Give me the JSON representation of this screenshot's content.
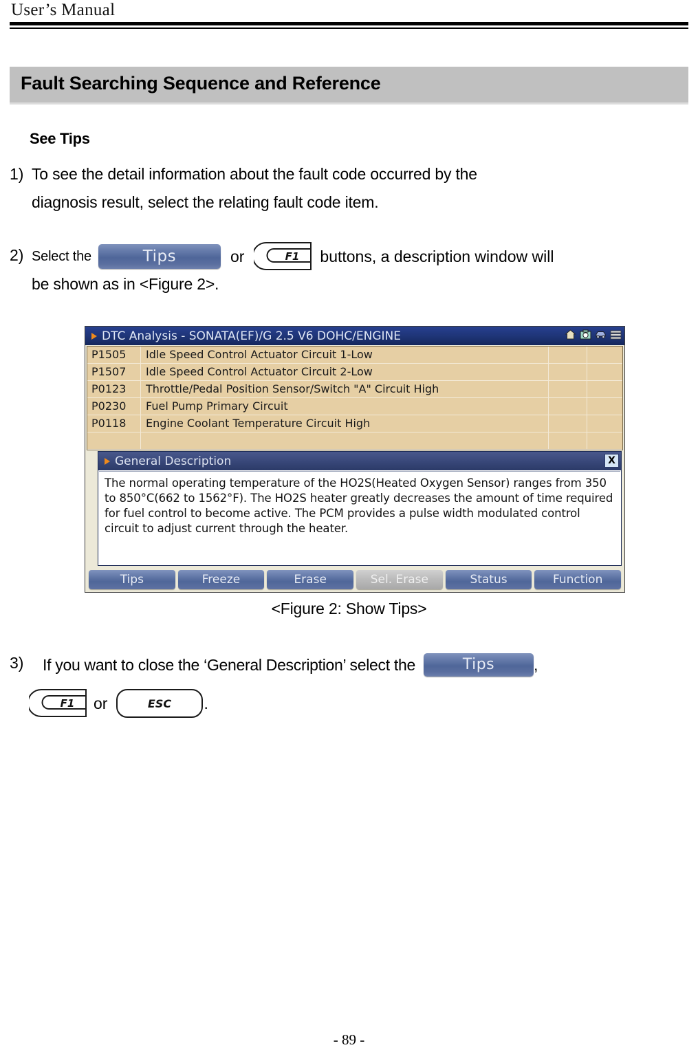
{
  "header": {
    "running_title": "User’s Manual"
  },
  "section": {
    "banner_title": "Fault Searching Sequence and Reference",
    "subheading": "See Tips"
  },
  "steps": [
    {
      "number": "1)",
      "line1": "To see the detail information about the fault code occurred by the",
      "line2": "diagnosis result, select the relating fault code item."
    },
    {
      "number": "2)",
      "prefix": "Select the",
      "between": "or",
      "suffix": "buttons, a description window will",
      "line2": "be shown as in <Figure 2>."
    },
    {
      "number": "3)",
      "prefix": "If you want to close the ‘General Description’ select the",
      "comma": ",",
      "between": "or",
      "period": "."
    }
  ],
  "keys": {
    "tips_label": "Tips",
    "f1_label": "F1",
    "esc_label": "ESC"
  },
  "figure": {
    "caption": "<Figure 2: Show Tips>",
    "titlebar": {
      "title": "DTC Analysis  - SONATA(EF)/G 2.5 V6 DOHC/ENGINE",
      "icons": [
        "home-icon",
        "camera-icon",
        "car-icon",
        "menu-icon"
      ]
    },
    "table": {
      "rows": [
        {
          "code": "P1505",
          "description": "Idle Speed Control Actuator Circuit 1-Low"
        },
        {
          "code": "P1507",
          "description": "Idle Speed Control Actuator Circuit 2-Low"
        },
        {
          "code": "P0123",
          "description": "Throttle/Pedal Position Sensor/Switch \"A\" Circuit High"
        },
        {
          "code": "P0230",
          "description": "Fuel Pump Primary Circuit"
        },
        {
          "code": "P0118",
          "description": "Engine Coolant Temperature Circuit High"
        },
        {
          "code": "",
          "description": ""
        }
      ]
    },
    "general_description": {
      "title": "General Description",
      "close_label": "X",
      "body": "The normal operating temperature of the HO2S(Heated Oxygen Sensor) ranges from 350 to 850°C(662 to 1562°F). The HO2S heater greatly decreases the amount of time required for fuel control to become active. The PCM provides a pulse width modulated control circuit to adjust current through the heater."
    },
    "buttons": [
      {
        "label": "Tips",
        "state": "enabled"
      },
      {
        "label": "Freeze",
        "state": "enabled"
      },
      {
        "label": "Erase",
        "state": "enabled"
      },
      {
        "label": "Sel. Erase",
        "state": "disabled"
      },
      {
        "label": "Status",
        "state": "enabled"
      },
      {
        "label": "Function",
        "state": "enabled"
      }
    ]
  },
  "footer": {
    "page_number": "- 89 -"
  },
  "colors": {
    "banner_grey": "#c0c0c0",
    "titlebar_blue": "#1f3578",
    "table_tan": "#e6cfa4",
    "button_blue": "#4f6699",
    "accent_orange": "#ef8a1c"
  }
}
